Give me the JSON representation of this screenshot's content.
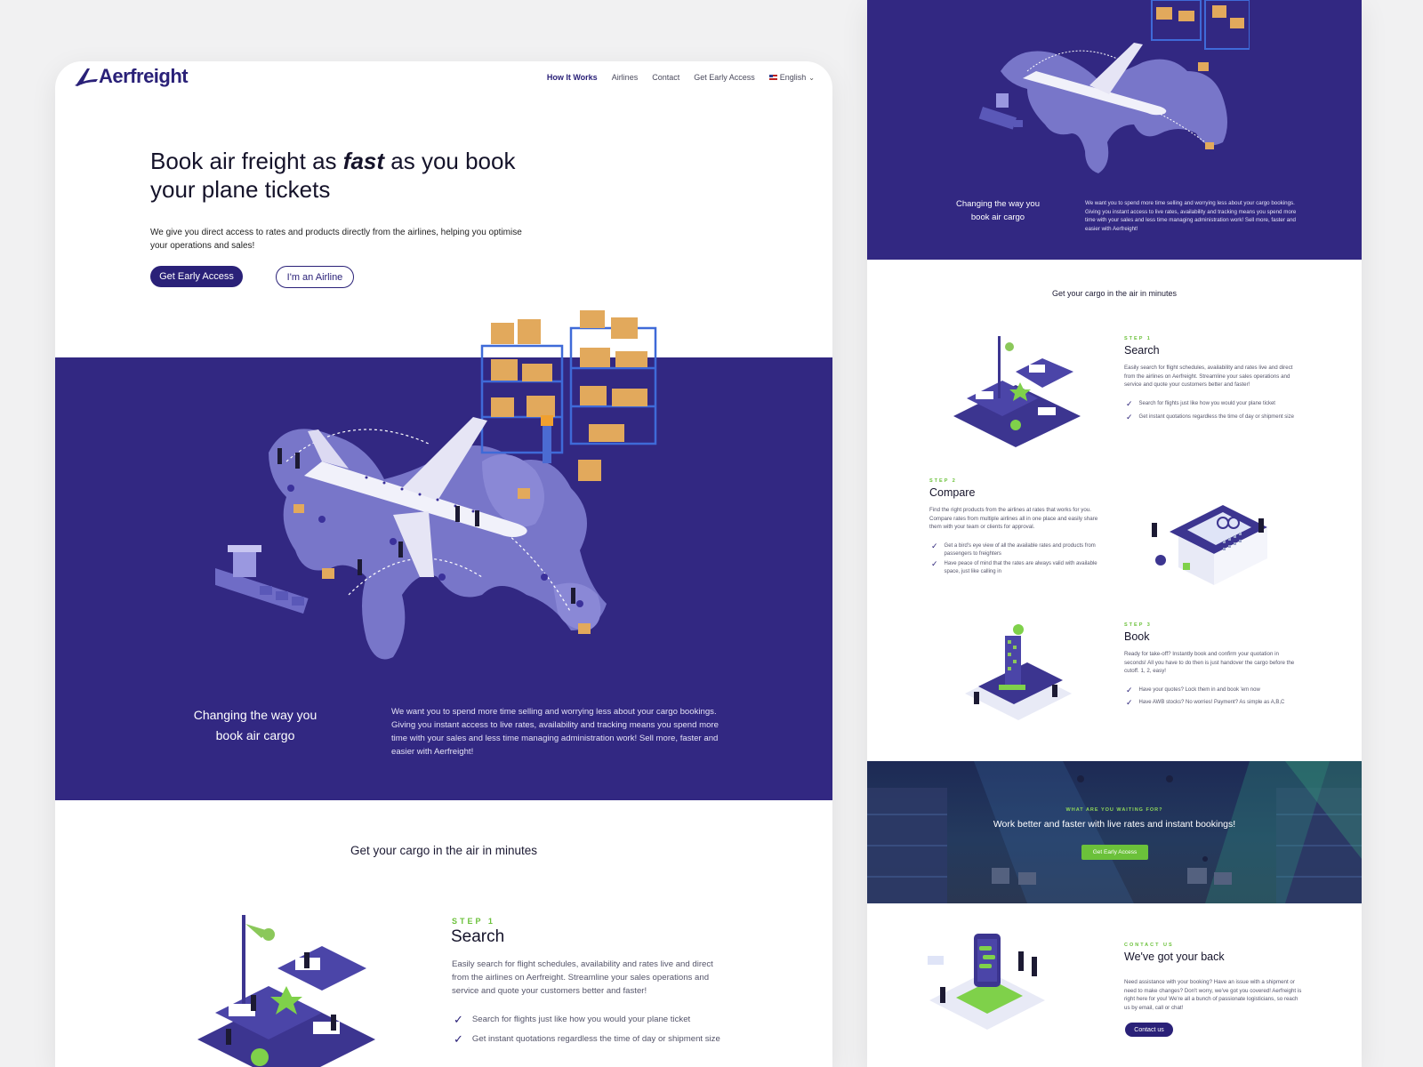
{
  "brand": {
    "name": "Aerfreight",
    "primary_color": "#2a2178",
    "band_color": "#322882",
    "accent_green": "#6bc13a"
  },
  "nav": {
    "links": [
      "How It Works",
      "Airlines",
      "Contact",
      "Get Early Access"
    ],
    "active": "How It Works",
    "language": "English"
  },
  "hero": {
    "title_before": "Book air freight as ",
    "title_emphasis": "fast",
    "title_after": " as you book your plane tickets",
    "subtitle": "We give you direct access to rates and products directly from the airlines, helping you optimise your operations and sales!",
    "primary_button": "Get Early Access",
    "secondary_button": "I'm an Airline"
  },
  "band": {
    "heading": "Changing the way you book air cargo",
    "text": "We want you to spend more time selling and worrying less about your cargo bookings. Giving you instant access to live rates, availability and tracking means you spend more time with your sales and less time managing administration work! Sell more, faster and easier with Aerfreight!"
  },
  "steps_section": {
    "title": "Get your cargo in the air in minutes",
    "steps": [
      {
        "label": "STEP 1",
        "title": "Search",
        "text": "Easily search for flight schedules, availability and rates live and direct from the airlines on Aerfreight. Streamline your sales operations and service and quote your customers better and faster!",
        "bullets": [
          "Search for flights just like how you would your plane ticket",
          "Get instant quotations regardless the time of day or shipment size"
        ]
      },
      {
        "label": "STEP 2",
        "title": "Compare",
        "text": "Find the right products from the airlines at rates that works for you. Compare rates from multiple airlines all in one place and easily share them with your team or clients for approval.",
        "bullets": [
          "Get a bird's eye view of all the available rates and products from passengers to freighters",
          "Have peace of mind that the rates are always valid with available space, just like calling in"
        ]
      },
      {
        "label": "STEP 3",
        "title": "Book",
        "text": "Ready for take-off? Instantly book and confirm your quotation in seconds! All you have to do then is just handover the cargo before the cutoff. 1, 2, easy!",
        "bullets": [
          "Have your quotes? Lock them in and book 'em now",
          "Have AWB stocks? No worries! Payment? As simple as A,B,C"
        ]
      }
    ]
  },
  "cta": {
    "label": "WHAT ARE YOU WAITING FOR?",
    "title": "Work better and faster with live rates and instant bookings!",
    "button": "Get Early Access"
  },
  "contact": {
    "label": "CONTACT US",
    "title": "We've got your back",
    "text": "Need assistance with your booking? Have an issue with a shipment or need to make changes? Don't worry, we've got you covered! Aerfreight is right here for you! We're all a bunch of passionate logisticians, so reach us by email, call or chat!",
    "button": "Contact us"
  },
  "icons": [
    "logo-wing-icon",
    "chevron-down-icon",
    "flag-icon",
    "checkmark-icon"
  ]
}
